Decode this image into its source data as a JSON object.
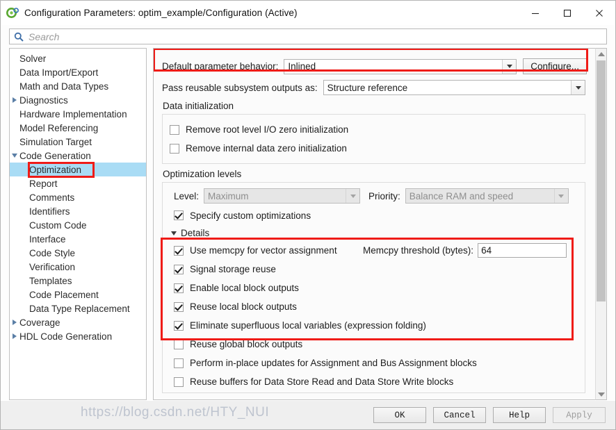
{
  "window": {
    "title": "Configuration Parameters: optim_example/Configuration (Active)",
    "app_icon": "simulink-icon",
    "minimize": "—",
    "maximize": "□",
    "close": "✕"
  },
  "search": {
    "placeholder": "Search",
    "value": "",
    "icon": "search-icon"
  },
  "sidebar": {
    "items": [
      {
        "label": "Solver",
        "level": 0,
        "arrow": "none",
        "selected": false
      },
      {
        "label": "Data Import/Export",
        "level": 0,
        "arrow": "none",
        "selected": false
      },
      {
        "label": "Math and Data Types",
        "level": 0,
        "arrow": "none",
        "selected": false
      },
      {
        "label": "Diagnostics",
        "level": 0,
        "arrow": "right",
        "selected": false
      },
      {
        "label": "Hardware Implementation",
        "level": 0,
        "arrow": "none",
        "selected": false
      },
      {
        "label": "Model Referencing",
        "level": 0,
        "arrow": "none",
        "selected": false
      },
      {
        "label": "Simulation Target",
        "level": 0,
        "arrow": "none",
        "selected": false
      },
      {
        "label": "Code Generation",
        "level": 0,
        "arrow": "down",
        "selected": false
      },
      {
        "label": "Optimization",
        "level": 1,
        "arrow": "none",
        "selected": true
      },
      {
        "label": "Report",
        "level": 1,
        "arrow": "none",
        "selected": false
      },
      {
        "label": "Comments",
        "level": 1,
        "arrow": "none",
        "selected": false
      },
      {
        "label": "Identifiers",
        "level": 1,
        "arrow": "none",
        "selected": false
      },
      {
        "label": "Custom Code",
        "level": 1,
        "arrow": "none",
        "selected": false
      },
      {
        "label": "Interface",
        "level": 1,
        "arrow": "none",
        "selected": false
      },
      {
        "label": "Code Style",
        "level": 1,
        "arrow": "none",
        "selected": false
      },
      {
        "label": "Verification",
        "level": 1,
        "arrow": "none",
        "selected": false
      },
      {
        "label": "Templates",
        "level": 1,
        "arrow": "none",
        "selected": false
      },
      {
        "label": "Code Placement",
        "level": 1,
        "arrow": "none",
        "selected": false
      },
      {
        "label": "Data Type Replacement",
        "level": 1,
        "arrow": "none",
        "selected": false
      },
      {
        "label": "Coverage",
        "level": 0,
        "arrow": "right",
        "selected": false
      },
      {
        "label": "HDL Code Generation",
        "level": 0,
        "arrow": "right",
        "selected": false
      }
    ]
  },
  "main": {
    "default_parameter_behavior": {
      "label": "Default parameter behavior:",
      "value": "Inlined",
      "configure_label": "Configure..."
    },
    "pass_reusable": {
      "label": "Pass reusable subsystem outputs as:",
      "value": "Structure reference"
    },
    "data_initialization": {
      "title": "Data initialization",
      "options": [
        {
          "label": "Remove root level I/O zero initialization",
          "checked": false
        },
        {
          "label": "Remove internal data zero initialization",
          "checked": false
        }
      ]
    },
    "optimization_levels": {
      "title": "Optimization levels",
      "level_label": "Level:",
      "level_value": "Maximum",
      "level_disabled": true,
      "priority_label": "Priority:",
      "priority_value": "Balance RAM and speed",
      "priority_disabled": true,
      "specify_custom": {
        "label": "Specify custom optimizations",
        "checked": true
      },
      "details_label": "Details",
      "memcpy_threshold": {
        "label": "Memcpy threshold (bytes):",
        "value": "64"
      },
      "details_options": [
        {
          "label": "Use memcpy for vector assignment",
          "checked": true
        },
        {
          "label": "Signal storage reuse",
          "checked": true
        },
        {
          "label": "Enable local block outputs",
          "checked": true
        },
        {
          "label": "Reuse local block outputs",
          "checked": true
        },
        {
          "label": "Eliminate superfluous local variables (expression folding)",
          "checked": true
        },
        {
          "label": "Reuse global block outputs",
          "checked": false
        },
        {
          "label": "Perform in-place updates for Assignment and Bus Assignment blocks",
          "checked": false
        },
        {
          "label": "Reuse buffers for Data Store Read and Data Store Write blocks",
          "checked": false
        }
      ]
    }
  },
  "footer": {
    "ok": "OK",
    "cancel": "Cancel",
    "help": "Help",
    "apply": "Apply",
    "apply_disabled": true,
    "watermark": "https://blog.csdn.net/HTY_NUI"
  },
  "colors": {
    "annotation_red": "#ef1b17",
    "selection_blue": "#a9dcf5",
    "search_icon_blue": "#3f6fa8"
  }
}
